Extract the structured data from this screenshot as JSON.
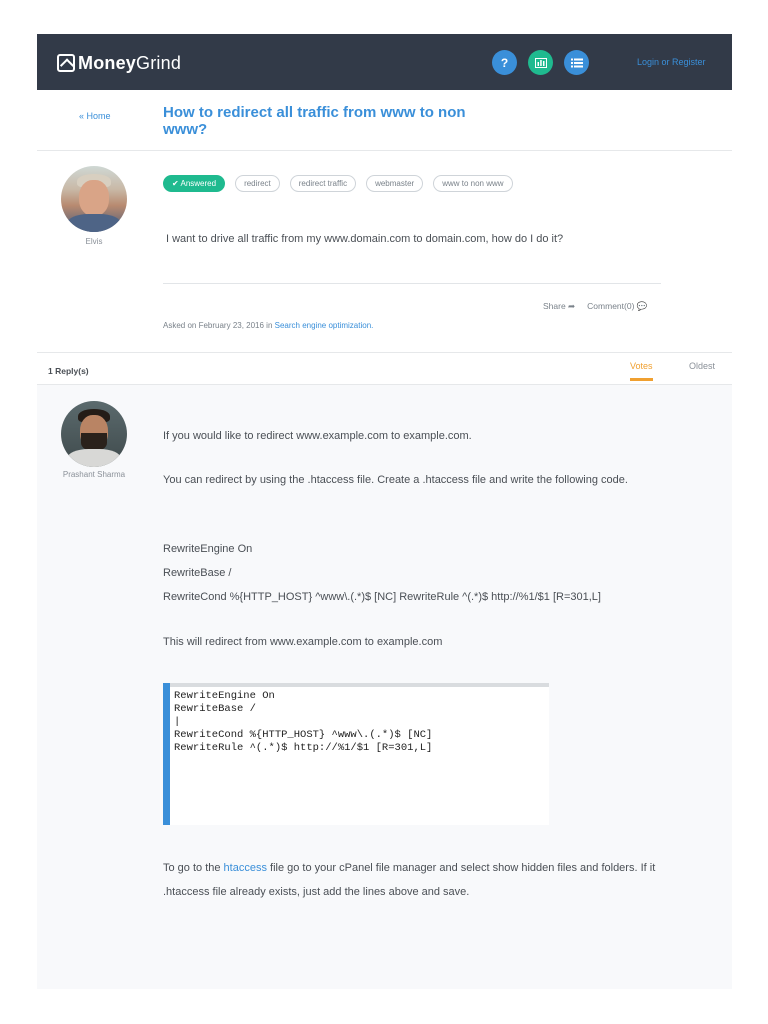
{
  "header": {
    "brand_bold": "Money",
    "brand_light": "Grind",
    "help_icon": "?",
    "login_register": "Login or Register"
  },
  "titlebar": {
    "home_link": "« Home",
    "title": "How to redirect all traffic from www to non www?"
  },
  "question": {
    "author": "Elvis",
    "tags": [
      "✔ Answered",
      "redirect",
      "redirect traffic",
      "webmaster",
      "www to non www"
    ],
    "body": "I want to drive all traffic from my www.domain.com to domain.com, how do I do it?",
    "share_label": "Share ➦",
    "comment_label": "Comment(0) 💬",
    "asked_prefix": "Asked on February 23, 2016 in",
    "category": "Search engine optimization."
  },
  "replies": {
    "count_label": "1 Reply(s)",
    "tab_votes": "Votes",
    "tab_oldest": "Oldest"
  },
  "answer": {
    "author": "Prashant Sharma",
    "p1": "If you would like to redirect www.example.com to example.com.",
    "p2": "You can redirect by using the .htaccess file. Create a .htaccess file and write the following code.",
    "code1": "RewriteEngine On",
    "code2": "RewriteBase /",
    "code3": "RewriteCond %{HTTP_HOST} ^www\\.(.*)$ [NC] RewriteRule ^(.*)$ http://%1/$1 [R=301,L]",
    "p3": "This will redirect from www.example.com to example.com",
    "code_image_text": "RewriteEngine On\nRewriteBase /\n|\nRewriteCond %{HTTP_HOST} ^www\\.(.*)$ [NC]\nRewriteRule ^(.*)$ http://%1/$1 [R=301,L]",
    "p4_before": "To go to the ",
    "p4_link": "htaccess",
    "p4_after": " file go to your cPanel file manager and select show hidden files and folders. If it .htaccess file already exists, just add the lines above and save."
  },
  "colors": {
    "header_bg": "#323a48",
    "accent_blue": "#3a8fd9",
    "accent_green": "#1fba8f",
    "accent_orange": "#f0a030"
  },
  "icons": [
    "logo-icon",
    "help-icon",
    "chart-icon",
    "list-icon",
    "share-icon",
    "comment-icon",
    "check-icon"
  ]
}
